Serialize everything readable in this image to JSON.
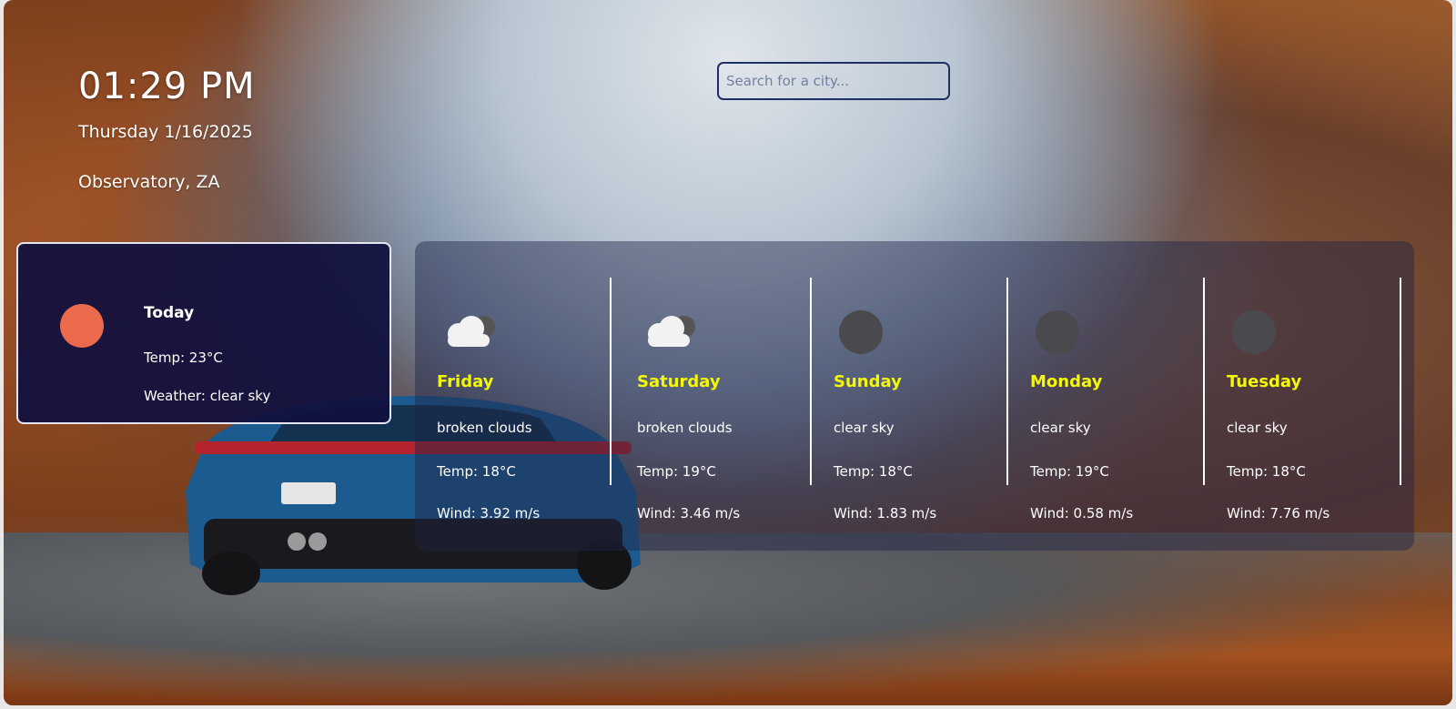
{
  "clock": {
    "time": "01:29 PM",
    "date": "Thursday 1/16/2025",
    "location": "Observatory, ZA"
  },
  "search": {
    "placeholder": "Search for a city..."
  },
  "today": {
    "title": "Today",
    "temp": "Temp: 23°C",
    "weather": "Weather: clear sky",
    "icon": "sun-icon"
  },
  "forecast": [
    {
      "day": "Friday",
      "desc": "broken clouds",
      "temp": "Temp: 18°C",
      "wind": "Wind: 3.92 m/s",
      "icon": "cloud-icon"
    },
    {
      "day": "Saturday",
      "desc": "broken clouds",
      "temp": "Temp: 19°C",
      "wind": "Wind: 3.46 m/s",
      "icon": "cloud-icon"
    },
    {
      "day": "Sunday",
      "desc": "clear sky",
      "temp": "Temp: 18°C",
      "wind": "Wind: 1.83 m/s",
      "icon": "moon-icon"
    },
    {
      "day": "Monday",
      "desc": "clear sky",
      "temp": "Temp: 19°C",
      "wind": "Wind: 0.58 m/s",
      "icon": "moon-icon"
    },
    {
      "day": "Tuesday",
      "desc": "clear sky",
      "temp": "Temp: 18°C",
      "wind": "Wind: 7.76 m/s",
      "icon": "moon-icon"
    }
  ],
  "colors": {
    "day_label": "#f5f70a",
    "today_card_bg": "#10103e",
    "sun": "#ea6a4b",
    "search_border": "#1e2f66"
  }
}
